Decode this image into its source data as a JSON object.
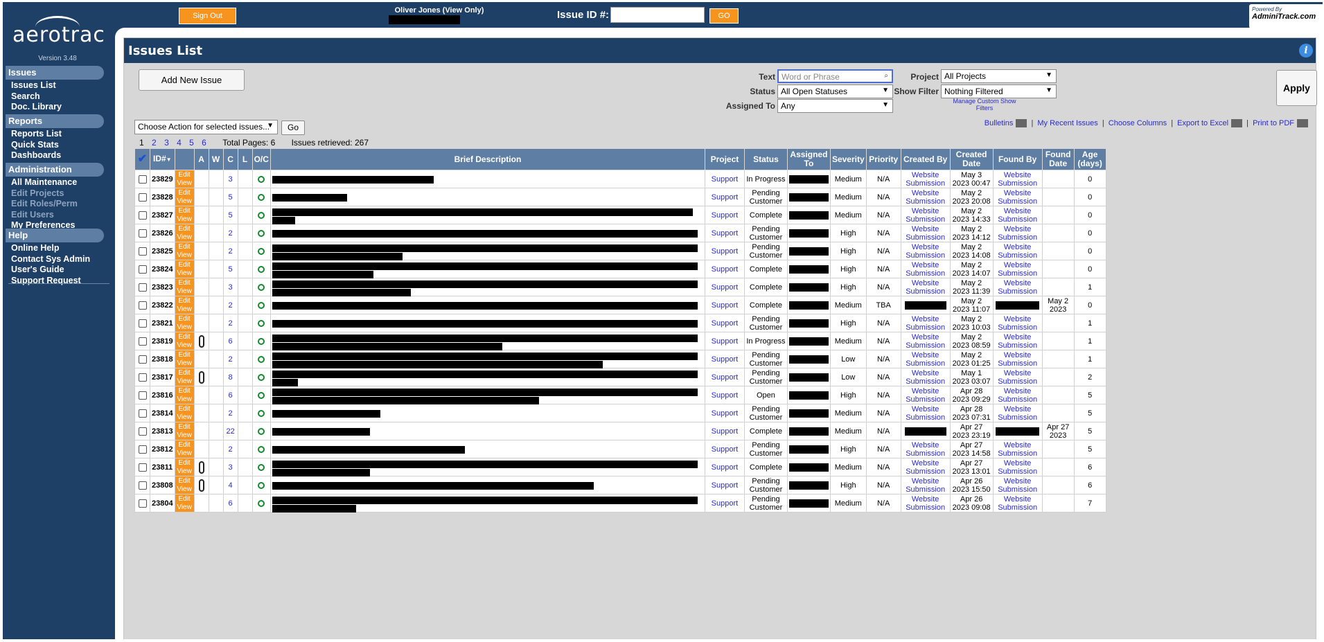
{
  "sidebar": {
    "logo": "aerotrac",
    "version": "Version 3.48",
    "sections": [
      {
        "title": "Issues",
        "items": [
          {
            "label": "Issues List",
            "enabled": true
          },
          {
            "label": "Search",
            "enabled": true
          },
          {
            "label": "Doc. Library",
            "enabled": true
          }
        ]
      },
      {
        "title": "Reports",
        "items": [
          {
            "label": "Reports List",
            "enabled": true
          },
          {
            "label": "Quick Stats",
            "enabled": true
          },
          {
            "label": "Dashboards",
            "enabled": true
          }
        ]
      },
      {
        "title": "Administration",
        "items": [
          {
            "label": "All Maintenance",
            "enabled": true
          },
          {
            "label": "Edit Projects",
            "enabled": false
          },
          {
            "label": "Edit Roles/Perm",
            "enabled": false
          },
          {
            "label": "Edit Users",
            "enabled": false
          },
          {
            "label": "My Preferences",
            "enabled": true
          }
        ]
      },
      {
        "title": "Help",
        "items": [
          {
            "label": "Online Help",
            "enabled": true
          },
          {
            "label": "Contact Sys Admin",
            "enabled": true
          },
          {
            "label": "User's Guide",
            "enabled": true
          },
          {
            "label": "Support Request",
            "enabled": true
          }
        ]
      }
    ]
  },
  "topbar": {
    "signout": "Sign Out",
    "user": "Oliver Jones (View Only)",
    "issue_id_label": "Issue ID #:",
    "go": "GO",
    "powered_by": "Powered By",
    "powered_brand": "AdminiTrack.com"
  },
  "panel": {
    "title": "Issues List",
    "info_icon": "i",
    "add_issue": "Add New Issue",
    "filters": {
      "text_label": "Text",
      "text_placeholder": "Word or Phrase",
      "status_label": "Status",
      "status_value": "All Open Statuses",
      "assigned_label": "Assigned To",
      "assigned_value": "Any",
      "project_label": "Project",
      "project_value": "All Projects",
      "show_filter_label": "Show Filter",
      "show_filter_value": "Nothing Filtered",
      "apply": "Apply",
      "manage": "Manage Custom Show Filters"
    },
    "action_select": "Choose Action for selected issues...",
    "action_go": "Go",
    "links": [
      "Bulletins",
      "My Recent Issues",
      "Choose Columns",
      "Export to Excel",
      "Print to PDF"
    ],
    "pages": [
      "1",
      "2",
      "3",
      "4",
      "5",
      "6"
    ],
    "current_page": "1",
    "total_pages": "Total Pages: 6",
    "retrieved": "Issues retrieved: 267"
  },
  "table": {
    "headers": [
      "✔",
      "ID#",
      "",
      "A",
      "W",
      "C",
      "L",
      "O/C",
      "Brief Description",
      "Project",
      "Status",
      "Assigned To",
      "Severity",
      "Priority",
      "Created By",
      "Created Date",
      "Found By",
      "Found Date",
      "Age (days)"
    ],
    "id_sort_arrow": "▼",
    "edit_label": "Edit",
    "view_label": "View",
    "rows": [
      {
        "id": "23829",
        "attach": false,
        "c": "3",
        "status": "In Progress",
        "severity": "Medium",
        "priority": "N/A",
        "created_by": "Website Submission",
        "created_date": "May 3 2023 00:47",
        "found_by": "Website Submission",
        "found_date": "",
        "age": "0"
      },
      {
        "id": "23828",
        "attach": false,
        "c": "5",
        "status": "Pending Customer",
        "severity": "Medium",
        "priority": "N/A",
        "created_by": "Website Submission",
        "created_date": "May 2 2023 20:08",
        "found_by": "Website Submission",
        "found_date": "",
        "age": "0"
      },
      {
        "id": "23827",
        "attach": false,
        "c": "5",
        "status": "Complete",
        "severity": "Medium",
        "priority": "N/A",
        "created_by": "Website Submission",
        "created_date": "May 2 2023 14:33",
        "found_by": "Website Submission",
        "found_date": "",
        "age": "0"
      },
      {
        "id": "23826",
        "attach": false,
        "c": "2",
        "status": "Pending Customer",
        "severity": "High",
        "priority": "N/A",
        "created_by": "Website Submission",
        "created_date": "May 2 2023 14:12",
        "found_by": "Website Submission",
        "found_date": "",
        "age": "0"
      },
      {
        "id": "23825",
        "attach": false,
        "c": "2",
        "status": "Pending Customer",
        "severity": "High",
        "priority": "N/A",
        "created_by": "Website Submission",
        "created_date": "May 2 2023 14:08",
        "found_by": "Website Submission",
        "found_date": "",
        "age": "0"
      },
      {
        "id": "23824",
        "attach": false,
        "c": "5",
        "status": "Complete",
        "severity": "High",
        "priority": "N/A",
        "created_by": "Website Submission",
        "created_date": "May 2 2023 14:07",
        "found_by": "Website Submission",
        "found_date": "",
        "age": "0"
      },
      {
        "id": "23823",
        "attach": false,
        "c": "3",
        "status": "Complete",
        "severity": "High",
        "priority": "N/A",
        "created_by": "Website Submission",
        "created_date": "May 2 2023 11:39",
        "found_by": "Website Submission",
        "found_date": "",
        "age": "1"
      },
      {
        "id": "23822",
        "attach": false,
        "c": "2",
        "status": "Complete",
        "severity": "Medium",
        "priority": "TBA",
        "created_by": "",
        "created_date": "May 2 2023 11:07",
        "found_by": "",
        "found_date": "May 2 2023",
        "age": "0"
      },
      {
        "id": "23821",
        "attach": false,
        "c": "2",
        "status": "Pending Customer",
        "severity": "High",
        "priority": "N/A",
        "created_by": "Website Submission",
        "created_date": "May 2 2023 10:03",
        "found_by": "Website Submission",
        "found_date": "",
        "age": "1"
      },
      {
        "id": "23819",
        "attach": true,
        "c": "6",
        "status": "In Progress",
        "severity": "Medium",
        "priority": "N/A",
        "created_by": "Website Submission",
        "created_date": "May 2 2023 08:59",
        "found_by": "Website Submission",
        "found_date": "",
        "age": "1"
      },
      {
        "id": "23818",
        "attach": false,
        "c": "2",
        "status": "Pending Customer",
        "severity": "Low",
        "priority": "N/A",
        "created_by": "Website Submission",
        "created_date": "May 2 2023 01:25",
        "found_by": "Website Submission",
        "found_date": "",
        "age": "1"
      },
      {
        "id": "23817",
        "attach": true,
        "c": "8",
        "status": "Pending Customer",
        "severity": "Low",
        "priority": "N/A",
        "created_by": "Website Submission",
        "created_date": "May 1 2023 03:07",
        "found_by": "Website Submission",
        "found_date": "",
        "age": "2"
      },
      {
        "id": "23816",
        "attach": false,
        "c": "6",
        "status": "Open",
        "severity": "High",
        "priority": "N/A",
        "created_by": "Website Submission",
        "created_date": "Apr 28 2023 09:29",
        "found_by": "Website Submission",
        "found_date": "",
        "age": "5"
      },
      {
        "id": "23814",
        "attach": false,
        "c": "2",
        "status": "Pending Customer",
        "severity": "Medium",
        "priority": "N/A",
        "created_by": "Website Submission",
        "created_date": "Apr 28 2023 07:31",
        "found_by": "Website Submission",
        "found_date": "",
        "age": "5"
      },
      {
        "id": "23813",
        "attach": false,
        "c": "22",
        "status": "Complete",
        "severity": "Medium",
        "priority": "N/A",
        "created_by": "",
        "created_date": "Apr 27 2023 23:19",
        "found_by": "",
        "found_date": "Apr 27 2023",
        "age": "5"
      },
      {
        "id": "23812",
        "attach": false,
        "c": "2",
        "status": "Pending Customer",
        "severity": "High",
        "priority": "N/A",
        "created_by": "Website Submission",
        "created_date": "Apr 27 2023 14:58",
        "found_by": "Website Submission",
        "found_date": "",
        "age": "5"
      },
      {
        "id": "23811",
        "attach": true,
        "c": "3",
        "status": "Complete",
        "severity": "Medium",
        "priority": "N/A",
        "created_by": "Website Submission",
        "created_date": "Apr 27 2023 13:01",
        "found_by": "Website Submission",
        "found_date": "",
        "age": "6"
      },
      {
        "id": "23808",
        "attach": true,
        "c": "4",
        "status": "Pending Customer",
        "severity": "High",
        "priority": "N/A",
        "created_by": "Website Submission",
        "created_date": "Apr 26 2023 15:50",
        "found_by": "Website Submission",
        "found_date": "",
        "age": "6"
      },
      {
        "id": "23804",
        "attach": false,
        "c": "6",
        "status": "Pending Customer",
        "severity": "Medium",
        "priority": "N/A",
        "created_by": "Website Submission",
        "created_date": "Apr 26 2023 09:08",
        "found_by": "Website Submission",
        "found_date": "",
        "age": "7"
      }
    ]
  },
  "colors": {
    "navy": "#1e3f66",
    "header_blue": "#5f7ea3",
    "orange": "#f7941d",
    "link": "#2a2acc",
    "open_green": "#148a2e"
  }
}
